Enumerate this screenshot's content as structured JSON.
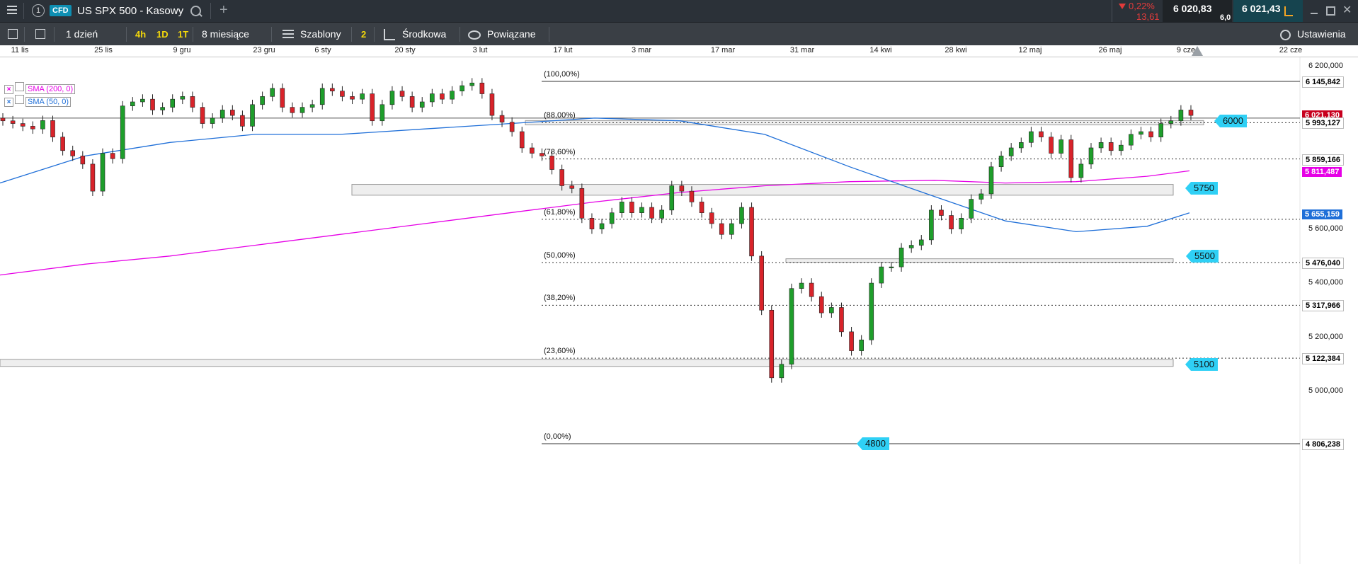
{
  "topbar": {
    "menu_icon": "hamburger-icon",
    "instrument_number": "1",
    "cfd_badge": "CFD",
    "instrument_name": "US SPX 500 - Kasowy",
    "change_pct": "0,22%",
    "change_abs": "13,61",
    "bid": "6 020,83",
    "ask": "6 021,43",
    "spread": "6,0"
  },
  "toolbar": {
    "interval": "1 dzień",
    "quick_4h": "4h",
    "quick_1d": "1D",
    "quick_1t": "1T",
    "range": "8 miesiące",
    "templates": "Szablony",
    "indicators_count": "2",
    "studies": "Środkowa",
    "linked": "Powiązane",
    "settings": "Ustawienia"
  },
  "date_axis": [
    "11 lis",
    "25 lis",
    "9 gru",
    "23 gru",
    "6 sty",
    "20 sty",
    "3 lut",
    "17 lut",
    "3 mar",
    "17 mar",
    "31 mar",
    "14 kwi",
    "28 kwi",
    "12 maj",
    "26 maj",
    "9 cze",
    "22 cze"
  ],
  "legend": [
    {
      "label": "SMA (200, 0)",
      "color": "#e600e6"
    },
    {
      "label": "SMA (50, 0)",
      "color": "#1f6fd8"
    }
  ],
  "price_axis": {
    "ticks": [
      "6 200,000",
      "5 600,000",
      "5 400,000",
      "5 200,000",
      "5 000,000"
    ],
    "markers": [
      {
        "label": "6 145,842",
        "value": 6145.842,
        "bg": "#ffffff",
        "fg": "#000000"
      },
      {
        "label": "6 021,130",
        "value": 6021.13,
        "bg": "#c8001e",
        "fg": "#ffffff"
      },
      {
        "label": "5 993,127",
        "value": 5993.127,
        "bg": "#ffffff",
        "fg": "#000000"
      },
      {
        "label": "5 859,166",
        "value": 5859.166,
        "bg": "#ffffff",
        "fg": "#000000"
      },
      {
        "label": "5 811,487",
        "value": 5811.487,
        "bg": "#e600e6",
        "fg": "#ffffff"
      },
      {
        "label": "5 655,159",
        "value": 5655.159,
        "bg": "#1f6fd8",
        "fg": "#ffffff"
      },
      {
        "label": "5 476,040",
        "value": 5476.04,
        "bg": "#ffffff",
        "fg": "#000000"
      },
      {
        "label": "5 317,966",
        "value": 5317.966,
        "bg": "#ffffff",
        "fg": "#000000"
      },
      {
        "label": "5 122,384",
        "value": 5122.384,
        "bg": "#ffffff",
        "fg": "#000000"
      },
      {
        "label": "4 806,238",
        "value": 4806.238,
        "bg": "#ffffff",
        "fg": "#000000"
      }
    ]
  },
  "fibonacci": [
    {
      "label": "(100,00%)",
      "value": 6145.842
    },
    {
      "label": "(88,00%)",
      "value": 5993.127
    },
    {
      "label": "(78,60%)",
      "value": 5859.166
    },
    {
      "label": "(61,80%)",
      "value": 5636.0
    },
    {
      "label": "(50,00%)",
      "value": 5476.04
    },
    {
      "label": "(38,20%)",
      "value": 5317.966
    },
    {
      "label": "(23,60%)",
      "value": 5122.384
    },
    {
      "label": "(0,00%)",
      "value": 4806.238
    }
  ],
  "levels": [
    {
      "label": "6000",
      "value": 6000
    },
    {
      "label": "5750",
      "value": 5750
    },
    {
      "label": "5500",
      "value": 5500
    },
    {
      "label": "5100",
      "value": 5100
    },
    {
      "label": "4800",
      "value": 4806.238
    }
  ],
  "chart_data": {
    "type": "candlestick",
    "instrument": "US SPX 500 - Kasowy",
    "interval": "1 dzień",
    "x": [
      "11 lis",
      "25 lis",
      "9 gru",
      "23 gru",
      "6 sty",
      "20 sty",
      "3 lut",
      "17 lut",
      "3 mar",
      "17 mar",
      "31 mar",
      "14 kwi",
      "28 kwi",
      "12 maj",
      "26 maj",
      "9 cze"
    ],
    "series": [
      {
        "name": "SMA (200, 0)",
        "values": [
          5430,
          5470,
          5500,
          5540,
          5580,
          5620,
          5660,
          5700,
          5735,
          5760,
          5775,
          5780,
          5770,
          5775,
          5795,
          5815
        ]
      },
      {
        "name": "SMA (50, 0)",
        "values": [
          5770,
          5870,
          5920,
          5950,
          5950,
          5970,
          5990,
          6010,
          6000,
          5950,
          5830,
          5720,
          5630,
          5590,
          5610,
          5660
        ]
      }
    ],
    "closes": [
      6000,
      5990,
      5980,
      5970,
      6001,
      5940,
      5890,
      5870,
      5840,
      5740,
      5880,
      5860,
      6055,
      6070,
      6080,
      6040,
      6050,
      6080,
      6090,
      6050,
      5990,
      6010,
      6040,
      6020,
      5980,
      6060,
      6090,
      6120,
      6050,
      6030,
      6050,
      6060,
      6120,
      6110,
      6090,
      6080,
      6100,
      6000,
      6060,
      6110,
      6090,
      6050,
      6070,
      6100,
      6080,
      6110,
      6130,
      6140,
      6100,
      6020,
      5995,
      5960,
      5900,
      5880,
      5870,
      5820,
      5760,
      5750,
      5640,
      5600,
      5620,
      5660,
      5700,
      5660,
      5680,
      5640,
      5670,
      5760,
      5740,
      5700,
      5660,
      5620,
      5580,
      5620,
      5680,
      5500,
      5300,
      5050,
      5100,
      5380,
      5400,
      5350,
      5290,
      5310,
      5220,
      5150,
      5190,
      5400,
      5460,
      5460,
      5530,
      5540,
      5560,
      5670,
      5650,
      5600,
      5640,
      5710,
      5730,
      5830,
      5870,
      5900,
      5920,
      5960,
      5940,
      5880,
      5930,
      5790,
      5840,
      5900,
      5920,
      5890,
      5910,
      5950,
      5960,
      5940,
      5990,
      6000,
      6040,
      6020
    ],
    "ylim": [
      4790,
      6230
    ]
  }
}
